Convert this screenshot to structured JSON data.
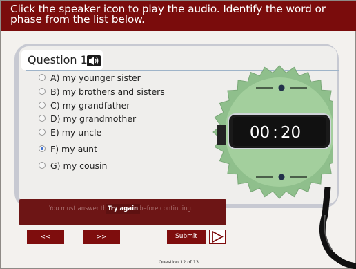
{
  "instructions": "Click the speaker icon to play the audio. Identify the word or phase from the list below.",
  "question": {
    "title": "Question 12",
    "options": [
      {
        "label": "A) my younger sister",
        "selected": false
      },
      {
        "label": "B) my brothers and sisters",
        "selected": false
      },
      {
        "label": "C) my grandfather",
        "selected": false
      },
      {
        "label": "D) my grandmother",
        "selected": false
      },
      {
        "label": "E) my uncle",
        "selected": false
      },
      {
        "label": "F) my aunt",
        "selected": true
      },
      {
        "label": "G) my cousin",
        "selected": false
      }
    ]
  },
  "timer": {
    "minutes": "00",
    "separator": ":",
    "seconds": "20"
  },
  "error": {
    "message": "You must answer the question before continuing.",
    "try_again_label": "Try again"
  },
  "nav": {
    "prev_label": "<<",
    "next_label": ">>",
    "submit_label": "Submit"
  },
  "footer": {
    "counter": "Question 12 of 13"
  },
  "colors": {
    "brand": "#7a0c0c",
    "button": "#7e0d0d",
    "badge": "#8fbf8c",
    "accent": "#3b6fd1"
  },
  "icons": {
    "speaker": "speaker-icon",
    "play": "play-icon"
  }
}
